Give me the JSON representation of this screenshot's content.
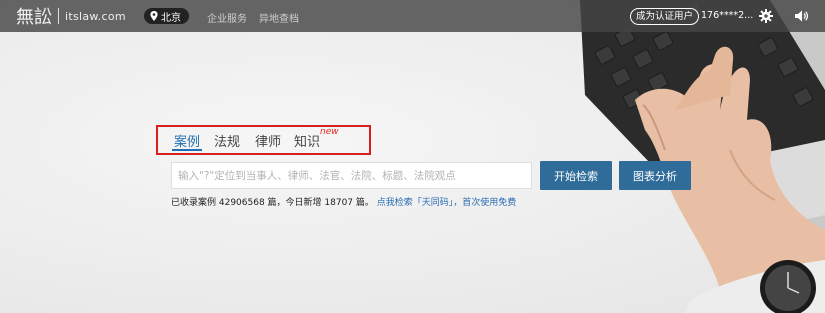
{
  "header": {
    "logo_text": "無訟",
    "domain_text": "itslaw.com",
    "city": "北京",
    "nav": [
      {
        "label": "企业服务"
      },
      {
        "label": "异地查档"
      }
    ],
    "verify_label": "成为认证用户",
    "user_phone": "176****2..."
  },
  "search": {
    "tabs": [
      {
        "label": "案例",
        "active": true
      },
      {
        "label": "法规",
        "active": false
      },
      {
        "label": "律师",
        "active": false
      },
      {
        "label": "知识",
        "active": false
      }
    ],
    "new_badge": "new",
    "placeholder": "输入\"?\"定位到当事人、律师、法官、法院、标题、法院观点",
    "search_button": "开始检索",
    "chart_button": "图表分析"
  },
  "stats": {
    "text": "已收录案例 42906568 篇，今日新增 18707 篇。",
    "link1": "点我检索「天同码」",
    "sep": "，",
    "link2": "首次使用免费"
  },
  "colors": {
    "accent": "#2f6c9a",
    "link": "#2a6cb3",
    "highlight_box": "#d81e1e",
    "new_badge": "#e0261f"
  }
}
